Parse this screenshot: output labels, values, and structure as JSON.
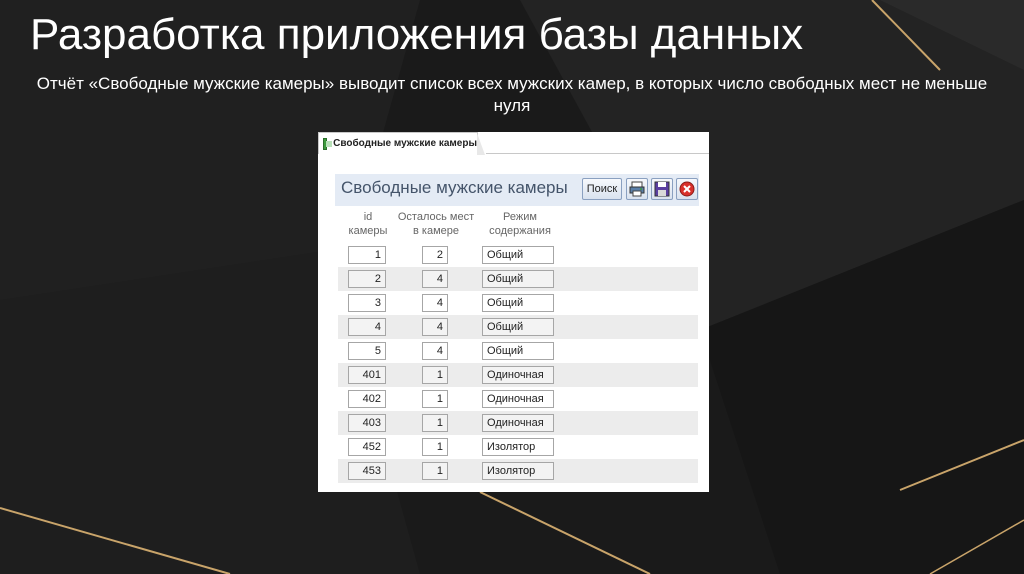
{
  "slide": {
    "title": "Разработка приложения базы данных",
    "subtitle": "Отчёт «Свободные мужские камеры» выводит список всех мужских камер, в которых число свободных мест не меньше нуля"
  },
  "window": {
    "tab_label": "Свободные мужские камеры",
    "report_title": "Свободные мужские камеры",
    "search_button_label": "Поиск",
    "toolbar_icons": [
      "print-icon",
      "save-icon",
      "close-icon"
    ]
  },
  "table": {
    "columns": [
      "id камеры",
      "Осталось мест в камере",
      "Режим содержания"
    ],
    "column_lines": [
      [
        "id",
        "камеры"
      ],
      [
        "Осталось мест",
        "в камере"
      ],
      [
        "Режим",
        "содержания"
      ]
    ],
    "rows": [
      {
        "id": "1",
        "free": "2",
        "mode": "Общий"
      },
      {
        "id": "2",
        "free": "4",
        "mode": "Общий"
      },
      {
        "id": "3",
        "free": "4",
        "mode": "Общий"
      },
      {
        "id": "4",
        "free": "4",
        "mode": "Общий"
      },
      {
        "id": "5",
        "free": "4",
        "mode": "Общий"
      },
      {
        "id": "401",
        "free": "1",
        "mode": "Одиночная"
      },
      {
        "id": "402",
        "free": "1",
        "mode": "Одиночная"
      },
      {
        "id": "403",
        "free": "1",
        "mode": "Одиночная"
      },
      {
        "id": "452",
        "free": "1",
        "mode": "Изолятор"
      },
      {
        "id": "453",
        "free": "1",
        "mode": "Изолятор"
      }
    ]
  },
  "colors": {
    "background": "#1c1c1c",
    "accent_gold": "#c9a46a",
    "header_band": "#e4ebf5",
    "report_title_text": "#44546a",
    "close_button_red": "#d9312b"
  }
}
